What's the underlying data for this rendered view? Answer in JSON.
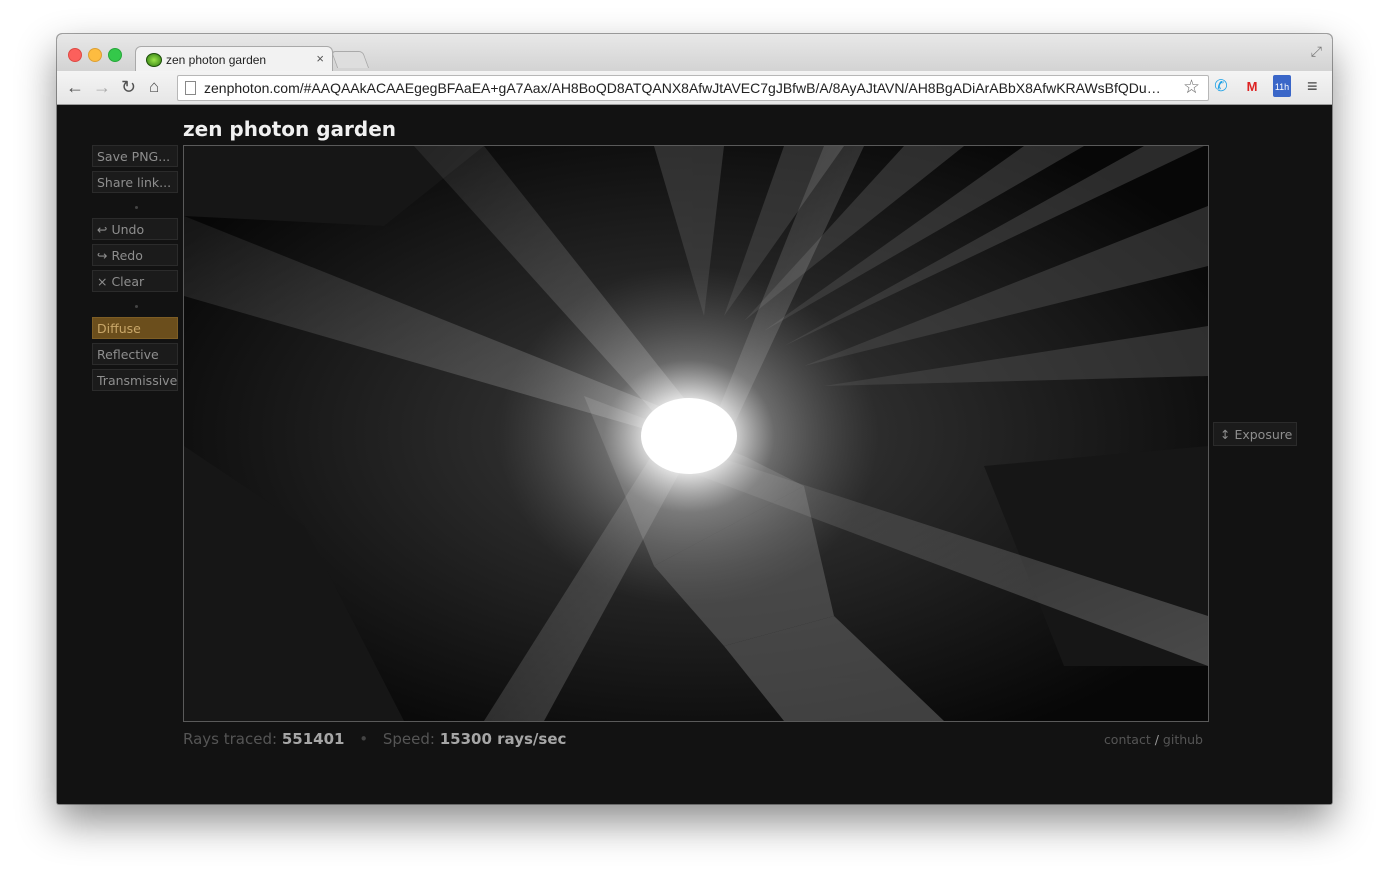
{
  "browser": {
    "tab_title": "zen photon garden",
    "tab_close": "×",
    "url": "zenphoton.com/#AAQAAkACAAEgegBFAaEA+gA7Aax/AH8BoQD8ATQANX8AfwJtAVEC7gJBfwB/A/8AyAJtAVN/AH8BgADiArABbX8AfwKRAWsBfQDufwB/..."
  },
  "app": {
    "title": "zen photon garden",
    "buttons": {
      "save": "Save PNG...",
      "share": "Share link...",
      "undo": "↩ Undo",
      "redo": "↪ Redo",
      "clear": "× Clear"
    },
    "materials": {
      "diffuse": "Diffuse",
      "reflective": "Reflective",
      "transmissive": "Transmissive",
      "selected": "Diffuse"
    },
    "exposure": "↕ Exposure",
    "stats": {
      "rays_label": "Rays traced:",
      "rays_value": "551401",
      "speed_label": "Speed:",
      "speed_value": "15300 rays/sec",
      "separator": "•"
    },
    "links": {
      "contact": "contact",
      "slash": "/",
      "github": "github"
    }
  },
  "colors": {
    "page_background": "#121212",
    "active_material": "#6b4e1c",
    "light": "#ffffff"
  }
}
